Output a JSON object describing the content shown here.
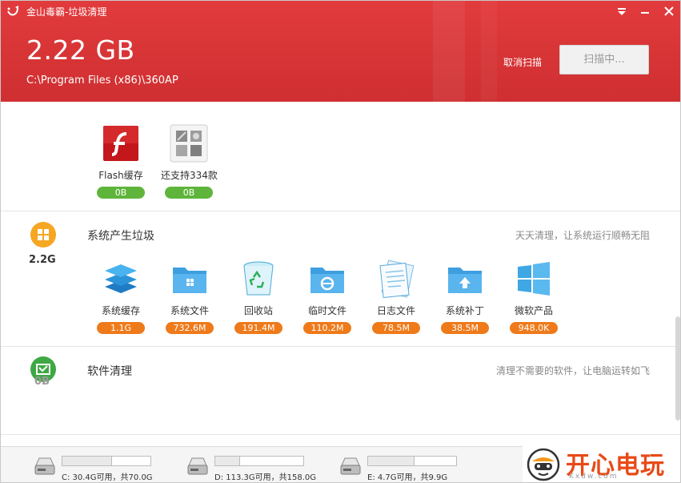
{
  "window": {
    "title": "金山毒霸-垃圾清理"
  },
  "header": {
    "scanned_size": "2.22 GB",
    "current_path": "C:\\Program Files (x86)\\360AP",
    "cancel_label": "取消扫描",
    "scan_button_label": "扫描中..."
  },
  "top_items": [
    {
      "label": "Flash缓存",
      "size": "0B",
      "icon": "flash-icon"
    },
    {
      "label": "还支持334款",
      "size": "0B",
      "icon": "apps-grid-icon"
    }
  ],
  "system_section": {
    "title": "系统产生垃圾",
    "size": "2.2G",
    "description": "天天清理，让系统运行顺畅无阻",
    "icon": "windows-icon",
    "items": [
      {
        "label": "系统缓存",
        "size": "1.1G",
        "icon": "layers-icon"
      },
      {
        "label": "系统文件",
        "size": "732.6M",
        "icon": "windows-folder-icon"
      },
      {
        "label": "回收站",
        "size": "191.4M",
        "icon": "recycle-bin-icon"
      },
      {
        "label": "临时文件",
        "size": "110.2M",
        "icon": "ie-folder-icon"
      },
      {
        "label": "日志文件",
        "size": "78.5M",
        "icon": "log-notepad-icon"
      },
      {
        "label": "系统补丁",
        "size": "38.5M",
        "icon": "patch-folder-icon"
      },
      {
        "label": "微软产品",
        "size": "948.0K",
        "icon": "microsoft-icon"
      }
    ]
  },
  "software_section": {
    "title": "软件清理",
    "size": "0B",
    "description": "清理不需要的软件，让电脑运转如飞",
    "icon": "software-clean-icon"
  },
  "drives": [
    {
      "text": "C: 30.4G可用，共70.0G",
      "used_fraction": 0.566
    },
    {
      "text": "D: 113.3G可用，共158.0G",
      "used_fraction": 0.283
    },
    {
      "text": "E: 4.7G可用，共9.9G",
      "used_fraction": 0.525
    }
  ],
  "watermark": {
    "text": "开心电玩",
    "sub": "Kxdw.com"
  },
  "colors": {
    "header_red": "#d73436",
    "green": "#5fb53b",
    "orange": "#ef7a1a",
    "section_icon_orange": "#f5a623"
  }
}
